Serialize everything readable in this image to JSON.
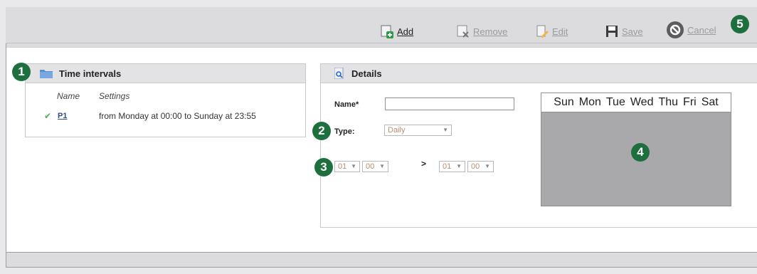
{
  "toolbar": {
    "add": "Add",
    "remove": "Remove",
    "edit": "Edit",
    "save": "Save",
    "cancel": "Cancel"
  },
  "badges": [
    "1",
    "2",
    "3",
    "4",
    "5"
  ],
  "time_intervals": {
    "title": "Time intervals",
    "columns": {
      "name": "Name",
      "settings": "Settings"
    },
    "rows": [
      {
        "name": "P1",
        "settings": "from Monday at 00:00 to Sunday at 23:55"
      }
    ]
  },
  "details": {
    "title": "Details",
    "name_label": "Name*",
    "name_value": "",
    "type_label": "Type:",
    "type_value": "Daily",
    "from_hour": "01",
    "from_min": "00",
    "arrow": ">",
    "to_hour": "01",
    "to_min": "00"
  },
  "calendar": {
    "days": [
      "Sun",
      "Mon",
      "Tue",
      "Wed",
      "Thu",
      "Fri",
      "Sat"
    ]
  },
  "colors": {
    "badge": "#1e6f3e",
    "check": "#4caf50",
    "select_text": "#b58f70"
  }
}
